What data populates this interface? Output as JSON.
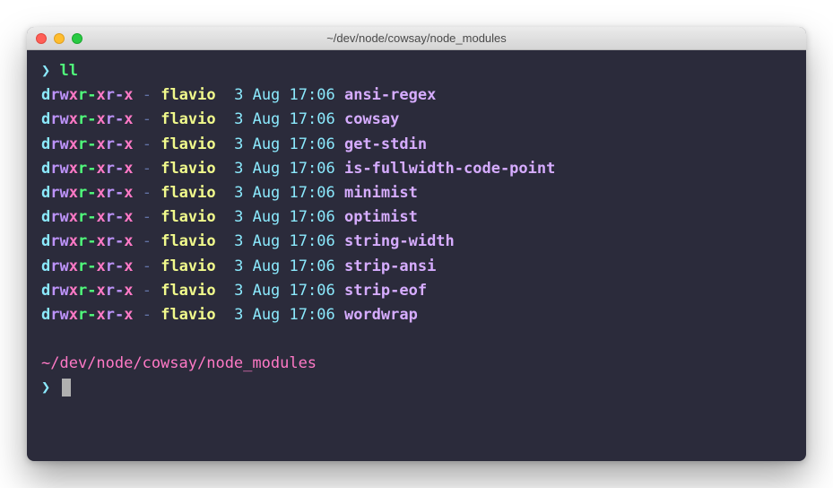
{
  "window": {
    "title": "~/dev/node/cowsay/node_modules"
  },
  "prompt_symbol": "❯",
  "command": "ll",
  "perm": {
    "d": "d",
    "rw": "rw",
    "x1": "x",
    "r2": "r-",
    "x2": "x",
    "r3": "r-",
    "x3": "x"
  },
  "dash": "-",
  "owner": "flavio",
  "date": "3 Aug 17:06",
  "entries": [
    {
      "name": "ansi-regex"
    },
    {
      "name": "cowsay"
    },
    {
      "name": "get-stdin"
    },
    {
      "name": "is-fullwidth-code-point"
    },
    {
      "name": "minimist"
    },
    {
      "name": "optimist"
    },
    {
      "name": "string-width"
    },
    {
      "name": "strip-ansi"
    },
    {
      "name": "strip-eof"
    },
    {
      "name": "wordwrap"
    }
  ],
  "cwd": "~/dev/node/cowsay/node_modules"
}
